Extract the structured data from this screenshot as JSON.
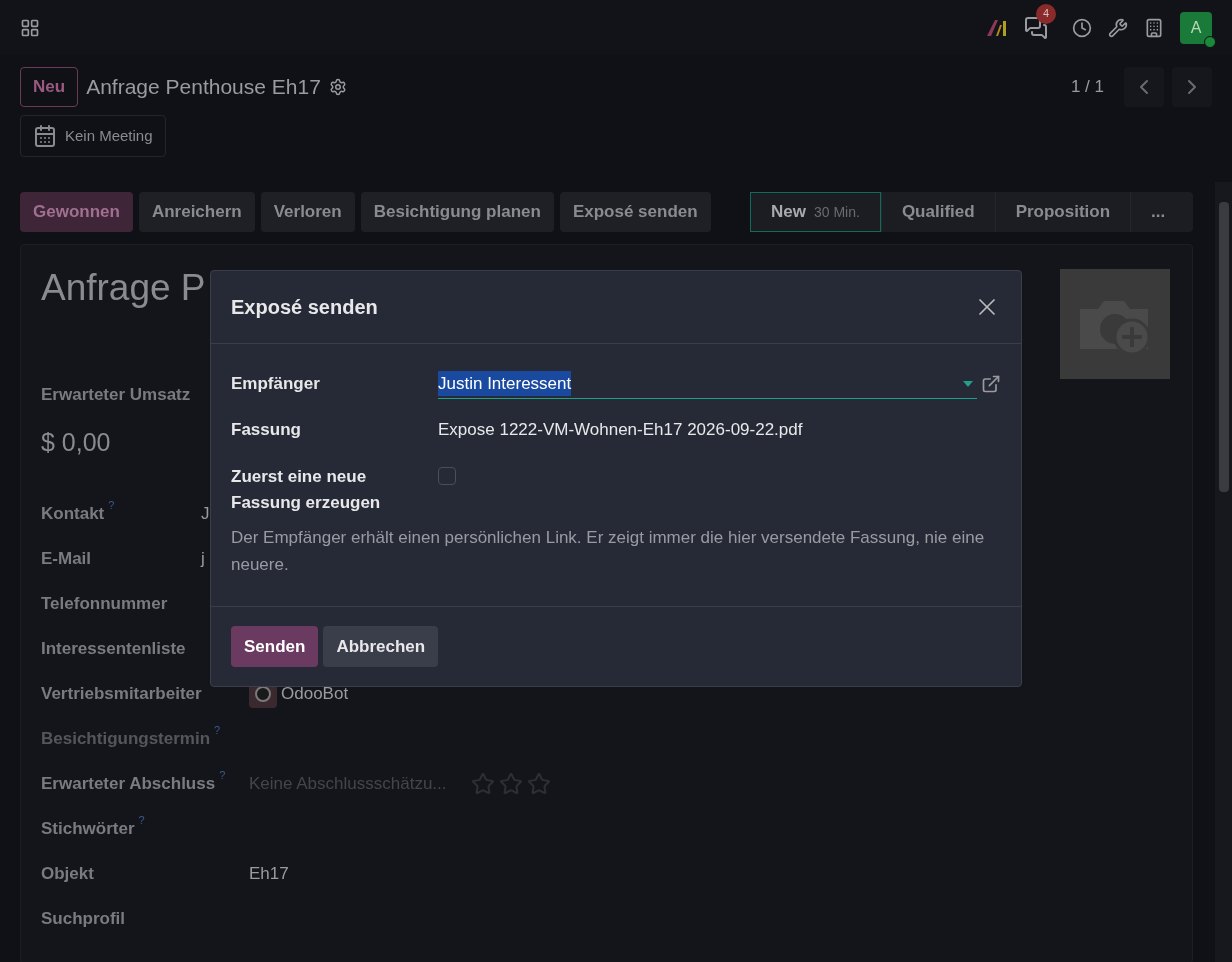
{
  "navbar": {
    "chat_badge": "4",
    "avatar_letter": "A"
  },
  "control_panel": {
    "new_button": "Neu",
    "breadcrumb": "Anfrage Penthouse Eh17",
    "pager": "1 / 1",
    "meeting_button": "Kein Meeting"
  },
  "actions": [
    {
      "label": "Gewonnen",
      "primary": true
    },
    {
      "label": "Anreichern",
      "primary": false
    },
    {
      "label": "Verloren",
      "primary": false
    },
    {
      "label": "Besichtigung planen",
      "primary": false
    },
    {
      "label": "Exposé senden",
      "primary": false
    }
  ],
  "stages": [
    {
      "label": "New",
      "note": "30 Min.",
      "selected": true
    },
    {
      "label": "Qualified",
      "selected": false
    },
    {
      "label": "Proposition",
      "selected": false
    },
    {
      "label": "...",
      "selected": false
    }
  ],
  "form": {
    "title": "Anfrage P",
    "revenue_label": "Erwarteter Umsatz",
    "revenue": "$ 0,00",
    "contact_fields": [
      {
        "label": "Kontakt",
        "help": "?",
        "kind": "text",
        "value": "J",
        "disabled": false
      },
      {
        "label": "E-Mail",
        "kind": "text",
        "value": "j",
        "disabled": false
      },
      {
        "label": "Telefonnummer",
        "kind": "text",
        "disabled": false
      },
      {
        "label": "Interessentenliste",
        "kind": "text",
        "disabled": false
      }
    ],
    "fields": [
      {
        "label": "Vertriebsmitarbeiter",
        "kind": "user",
        "value": "OdooBot",
        "disabled": false
      },
      {
        "label": "Besichtigungstermin",
        "help": "?",
        "kind": "text",
        "disabled": true
      },
      {
        "label": "Erwarteter Abschluss",
        "help": "?",
        "kind": "priority",
        "placeholder": "Keine Abschlussschätzu...",
        "stars": 0,
        "disabled": false
      },
      {
        "label": "Stichwörter",
        "help": "?",
        "kind": "text",
        "disabled": false
      },
      {
        "label": "Objekt",
        "kind": "text",
        "value": "Eh17",
        "disabled": false
      },
      {
        "label": "Suchprofil",
        "kind": "text",
        "disabled": false
      }
    ]
  },
  "dialog": {
    "title": "Exposé senden",
    "recipient": {
      "label": "Empfänger",
      "value": "Justin Interessent",
      "selected_text": true
    },
    "version": {
      "label": "Fassung",
      "value": "Expose 1222-VM-Wohnen-Eh17 2026-09-22.pdf"
    },
    "regenerate": {
      "label": "Zuerst eine neue Fassung erzeugen",
      "checked": false
    },
    "hint": "Der Empfänger erhält einen persönlichen Link. Er zeigt immer die hier versendete Fassung, nie eine neuere.",
    "buttons": [
      {
        "label": "Senden",
        "primary": true
      },
      {
        "label": "Abbrechen",
        "primary": false
      }
    ]
  }
}
